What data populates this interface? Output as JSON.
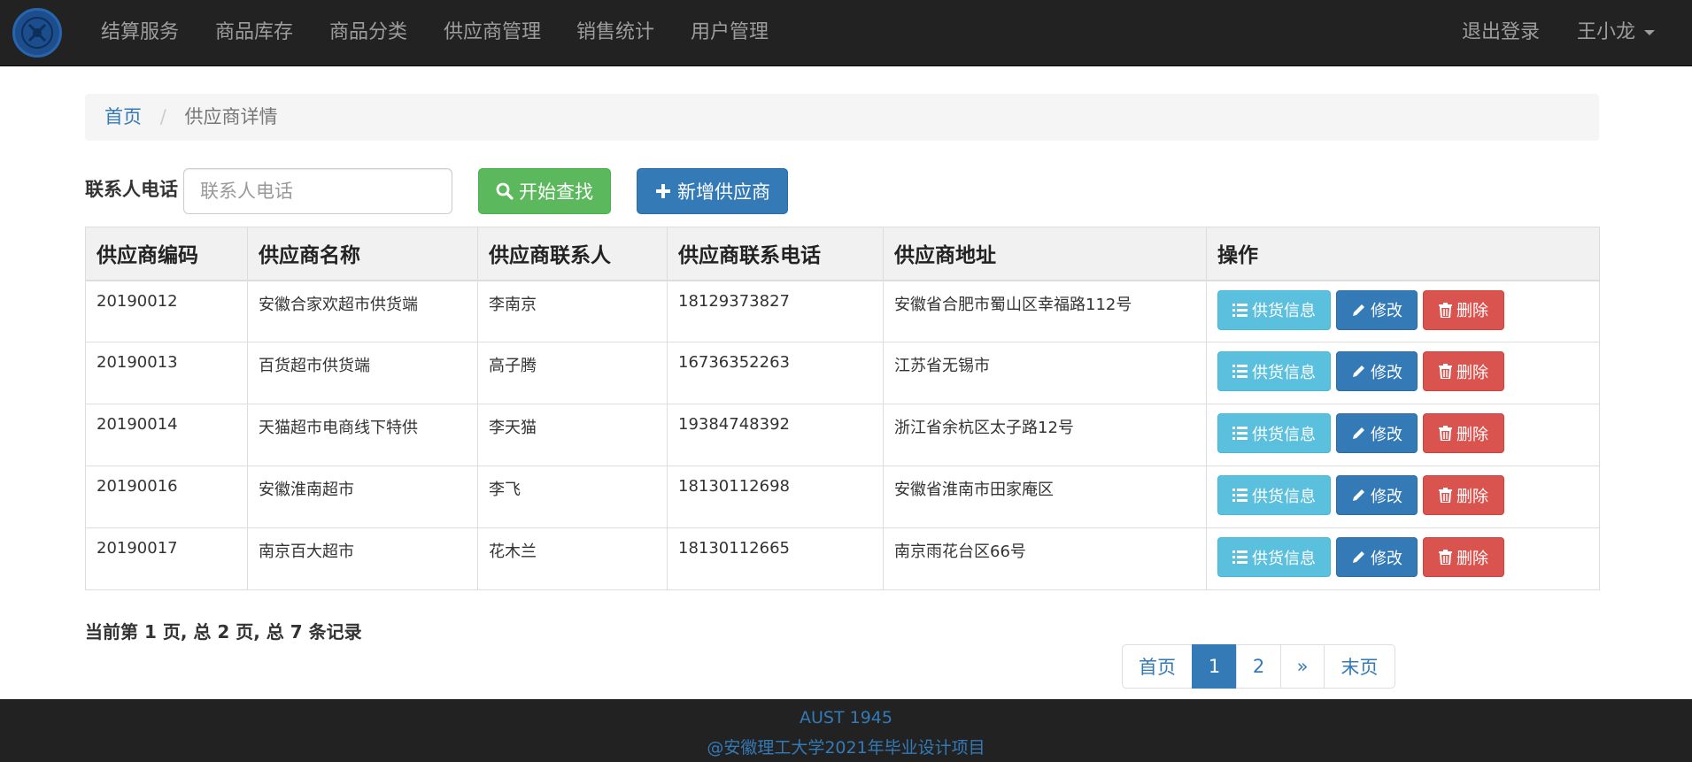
{
  "nav": {
    "items": [
      "结算服务",
      "商品库存",
      "商品分类",
      "供应商管理",
      "销售统计",
      "用户管理"
    ],
    "logout": "退出登录",
    "user": "王小龙"
  },
  "breadcrumb": {
    "home": "首页",
    "current": "供应商详情"
  },
  "search": {
    "label": "联系人电话",
    "placeholder": "联系人电话",
    "value": "",
    "search_button": "开始查找",
    "add_button": "新增供应商"
  },
  "table": {
    "headers": [
      "供应商编码",
      "供应商名称",
      "供应商联系人",
      "供应商联系电话",
      "供应商地址",
      "操作"
    ],
    "rows": [
      [
        "20190012",
        "安徽合家欢超市供货端",
        "李南京",
        "18129373827",
        "安徽省合肥市蜀山区幸福路112号"
      ],
      [
        "20190013",
        "百货超市供货端",
        "高子腾",
        "16736352263",
        "江苏省无锡市"
      ],
      [
        "20190014",
        "天猫超市电商线下特供",
        "李天猫",
        "19384748392",
        "浙江省余杭区太子路12号"
      ],
      [
        "20190016",
        "安徽淮南超市",
        "李飞",
        "18130112698",
        "安徽省淮南市田家庵区"
      ],
      [
        "20190017",
        "南京百大超市",
        "花木兰",
        "18130112665",
        "南京雨花台区66号"
      ]
    ],
    "actions": {
      "info": "供货信息",
      "edit": "修改",
      "delete": "删除"
    }
  },
  "summary": "当前第 1 页, 总 2 页, 总 7 条记录",
  "pagination": {
    "first": "首页",
    "pages": [
      "1",
      "2"
    ],
    "next": "»",
    "last": "末页",
    "active": "1"
  },
  "footer": {
    "line1": "AUST 1945",
    "line2": "@安徽理工大学2021年毕业设计项目"
  },
  "colors": {
    "navbar": "#222222",
    "primary": "#337ab7",
    "success": "#5cb85c",
    "info": "#5bc0de",
    "danger": "#d9534f"
  }
}
